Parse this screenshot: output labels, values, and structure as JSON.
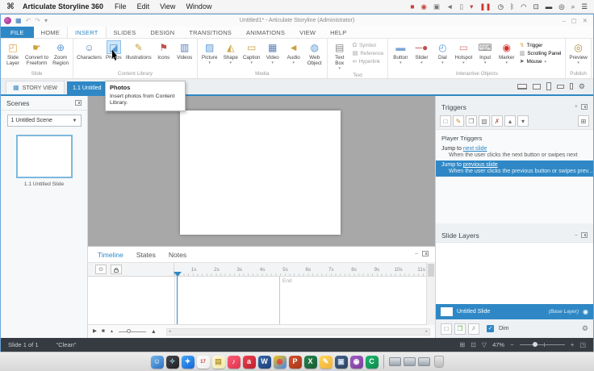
{
  "menubar": {
    "app_name": "Articulate Storyline 360",
    "menus": [
      "File",
      "Edit",
      "View",
      "Window"
    ],
    "status_icons": [
      {
        "name": "screen-record-stop-icon",
        "glyph": "■",
        "color": "#c8463c"
      },
      {
        "name": "record-dot-icon",
        "glyph": "◉",
        "color": "#c8463c"
      },
      {
        "name": "camera-status-icon",
        "glyph": "▣",
        "color": "#787878"
      },
      {
        "name": "volume-status-icon",
        "glyph": "◄",
        "color": "#787878"
      },
      {
        "name": "clipboard-status-icon",
        "glyph": "▯",
        "color": "#787878"
      },
      {
        "name": "notification-dot-icon",
        "glyph": "▾",
        "color": "#b8473c"
      },
      {
        "name": "pause-icon",
        "glyph": "❚❚",
        "color": "#d0342c"
      },
      {
        "name": "clock-icon",
        "glyph": "◷",
        "color": "#3a3a3a"
      },
      {
        "name": "bluetooth-icon",
        "glyph": "ᛒ",
        "color": "#3a3a3a"
      },
      {
        "name": "wifi-icon",
        "glyph": "◠",
        "color": "#3a3a3a"
      },
      {
        "name": "airplay-icon",
        "glyph": "⊡",
        "color": "#3a3a3a"
      },
      {
        "name": "battery-icon",
        "glyph": "▬",
        "color": "#3a3a3a"
      },
      {
        "name": "account-icon",
        "glyph": "◎",
        "color": "#3a3a3a"
      },
      {
        "name": "spotlight-search-icon",
        "glyph": "⌕",
        "color": "#3a3a3a"
      },
      {
        "name": "control-center-icon",
        "glyph": "☰",
        "color": "#3a3a3a"
      }
    ]
  },
  "titlebar": {
    "title": "Untitled1* - Articulate Storyline (Administrator)",
    "quick_access": [
      {
        "name": "storyline-app-icon",
        "type": "circle"
      },
      {
        "name": "save-button",
        "glyph": "▦",
        "color": "#2e75b6"
      },
      {
        "name": "undo-button",
        "glyph": "↶",
        "color": "#bcbcbc"
      },
      {
        "name": "redo-button",
        "glyph": "↷",
        "color": "#bcbcbc"
      },
      {
        "name": "quick-access-dropdown",
        "glyph": "▾",
        "color": "#9a9a9a"
      }
    ],
    "window_controls": [
      {
        "name": "minimize-button",
        "glyph": "–"
      },
      {
        "name": "maximize-button",
        "glyph": "▢"
      },
      {
        "name": "close-button",
        "glyph": "✕"
      }
    ]
  },
  "ribbon": {
    "tabs": [
      {
        "label": "FILE",
        "type": "file"
      },
      {
        "label": "HOME"
      },
      {
        "label": "INSERT",
        "active": true
      },
      {
        "label": "SLIDES"
      },
      {
        "label": "DESIGN"
      },
      {
        "label": "TRANSITIONS"
      },
      {
        "label": "ANIMATIONS"
      },
      {
        "label": "VIEW"
      },
      {
        "label": "HELP"
      }
    ],
    "groups": [
      {
        "name": "Slide",
        "buttons": [
          {
            "label": "Slide\nLayer",
            "icon": "slide-layer-icon",
            "glyph": "◰",
            "color": "#e0a04a"
          },
          {
            "label": "Convert to\nFreeform",
            "icon": "convert-to-freeform-icon",
            "glyph": "☛",
            "color": "#caa23c"
          },
          {
            "label": "Zoom\nRegion",
            "icon": "zoom-region-icon",
            "glyph": "⊕",
            "color": "#5b9bd5"
          }
        ]
      },
      {
        "name": "Content Library",
        "buttons": [
          {
            "label": "Characters",
            "icon": "characters-icon",
            "glyph": "☺",
            "color": "#5b7fb5"
          },
          {
            "label": "Photos",
            "icon": "photos-icon",
            "glyph": "◪",
            "color": "#5b9bd5",
            "highlighted": true
          },
          {
            "label": "Illustrations",
            "icon": "illustrations-icon",
            "glyph": "✎",
            "color": "#caa23c"
          },
          {
            "label": "Icons",
            "icon": "icons-icon",
            "glyph": "⚑",
            "color": "#c05050"
          },
          {
            "label": "Videos",
            "icon": "videos-icon",
            "glyph": "▥",
            "color": "#5b7fb5"
          }
        ]
      },
      {
        "name": "Media",
        "buttons": [
          {
            "label": "Picture",
            "icon": "picture-icon",
            "glyph": "▨",
            "color": "#5b9bd5",
            "arrow": true
          },
          {
            "label": "Shape",
            "icon": "shape-icon",
            "glyph": "◭",
            "color": "#caa23c",
            "arrow": true
          },
          {
            "label": "Caption",
            "icon": "caption-icon",
            "glyph": "▭",
            "color": "#caa23c",
            "arrow": true
          },
          {
            "label": "Video",
            "icon": "video-icon",
            "glyph": "▦",
            "color": "#5b7fb5",
            "arrow": true
          },
          {
            "label": "Audio",
            "icon": "audio-icon",
            "glyph": "◄",
            "color": "#caa23c",
            "arrow": true
          },
          {
            "label": "Web\nObject",
            "icon": "web-object-icon",
            "glyph": "◍",
            "color": "#5b9bd5"
          }
        ]
      },
      {
        "name": "Text",
        "buttons": [
          {
            "label": "Text\nBox",
            "icon": "text-box-icon",
            "glyph": "▤",
            "color": "#8a8a8a",
            "arrow": true
          }
        ],
        "small": [
          {
            "label": "Symbol",
            "icon": "symbol-icon",
            "glyph": "Ω",
            "color": "#9a9a9a",
            "muted": true
          },
          {
            "label": "Reference",
            "icon": "reference-icon",
            "glyph": "▤",
            "color": "#9a9a9a",
            "muted": true
          },
          {
            "label": "Hyperlink",
            "icon": "hyperlink-icon",
            "glyph": "∞",
            "color": "#9a9a9a",
            "muted": true
          }
        ]
      },
      {
        "name": "Interactive Objects",
        "buttons": [
          {
            "label": "Button",
            "icon": "button-icon",
            "glyph": "▬",
            "color": "#7da7d8",
            "arrow": true
          },
          {
            "label": "Slider",
            "icon": "slider-icon",
            "glyph": "─●",
            "color": "#c0504d",
            "arrow": true
          },
          {
            "label": "Dial",
            "icon": "dial-icon",
            "glyph": "◴",
            "color": "#5b9bd5",
            "arrow": true
          },
          {
            "label": "Hotspot",
            "icon": "hotspot-icon",
            "glyph": "▭",
            "color": "#d08080",
            "arrow": true
          },
          {
            "label": "Input",
            "icon": "input-icon",
            "glyph": "⌨",
            "color": "#8a8a8a",
            "arrow": true
          },
          {
            "label": "Marker",
            "icon": "marker-icon",
            "glyph": "◉",
            "color": "#d0342c",
            "arrow": true
          }
        ],
        "small": [
          {
            "label": "Trigger",
            "icon": "trigger-icon",
            "glyph": "↯",
            "color": "#e0a04a"
          },
          {
            "label": "Scrolling Panel",
            "icon": "scrolling-panel-icon",
            "glyph": "▥",
            "color": "#8a8a8a"
          },
          {
            "label": "Mouse",
            "icon": "mouse-icon",
            "glyph": "➤",
            "color": "#555555",
            "arrow": true
          }
        ]
      },
      {
        "name": "Publish",
        "buttons": [
          {
            "label": "Preview",
            "icon": "preview-icon",
            "glyph": "◎",
            "color": "#b0893c",
            "arrow": true
          }
        ]
      }
    ]
  },
  "view_tabs": {
    "story_view": "STORY VIEW",
    "active_slide": "1.1 Untitled "
  },
  "tooltip": {
    "title": "Photos",
    "body": "Insert photos from Content Library."
  },
  "scenes": {
    "title": "Scenes",
    "scene_selector": "1 Untitled Scene",
    "slide_label": "1.1 Untitled Slide"
  },
  "triggers": {
    "title": "Triggers",
    "toolbar_icons": [
      {
        "name": "new-trigger-icon",
        "glyph": "□",
        "color": "#777777"
      },
      {
        "name": "edit-trigger-icon",
        "glyph": "✎",
        "color": "#c98c2c"
      },
      {
        "name": "copy-trigger-icon",
        "glyph": "❐",
        "color": "#777777"
      },
      {
        "name": "paste-trigger-icon",
        "glyph": "▧",
        "color": "#777777"
      },
      {
        "name": "delete-trigger-icon",
        "glyph": "✗",
        "color": "#a95c52"
      },
      {
        "name": "move-trigger-up-icon",
        "glyph": "▴",
        "color": "#666666"
      },
      {
        "name": "move-trigger-down-icon",
        "glyph": "▾",
        "color": "#666666"
      }
    ],
    "variables_icon": {
      "name": "manage-variables-icon",
      "glyph": "⊞",
      "color": "#666666"
    },
    "section_title": "Player Triggers",
    "items": [
      {
        "prefix": "Jump to ",
        "link": "next slide",
        "desc": "When the user clicks the next button or swipes next",
        "selected": false
      },
      {
        "prefix": "Jump to ",
        "link": "previous slide",
        "desc": "When the user clicks the previous button or swipes prev...",
        "selected": true
      }
    ]
  },
  "slide_layers": {
    "title": "Slide Layers",
    "base_row": {
      "name": "Untitled Slide",
      "badge": "(Base Layer)"
    },
    "toolbar": {
      "icons": [
        {
          "name": "new-layer-icon",
          "glyph": "□",
          "color": "#777777"
        },
        {
          "name": "duplicate-layer-icon",
          "glyph": "❐",
          "color": "#5a9e4b"
        },
        {
          "name": "delete-layer-icon",
          "glyph": "✗",
          "color": "#bbbbbb"
        }
      ],
      "dim_label": "Dim",
      "dim_checked": true
    }
  },
  "timeline": {
    "tabs": [
      {
        "label": "Timeline",
        "active": true
      },
      {
        "label": "States"
      },
      {
        "label": "Notes"
      }
    ],
    "ticks": [
      "1s",
      "2s",
      "3s",
      "4s",
      "5s",
      "6s",
      "7s",
      "8s",
      "9s",
      "10s",
      "11s"
    ],
    "end_label": "End"
  },
  "statusbar": {
    "slide_info": "Slide 1 of 1",
    "theme_name": "\"Clean\"",
    "left_icons": [
      {
        "name": "grid-view-icon",
        "glyph": "⊞"
      },
      {
        "name": "fit-slide-icon",
        "glyph": "⊡"
      },
      {
        "name": "filter-icon",
        "glyph": "▽"
      }
    ],
    "zoom_value": "47%",
    "zoom_out_glyph": "−",
    "zoom_in_glyph": "+",
    "fit_window_icon": {
      "name": "fit-to-window-icon",
      "glyph": "◳"
    }
  },
  "dock": {
    "apps": [
      {
        "name": "finder",
        "c1": "#74b6ea",
        "c2": "#2d6fc1",
        "glyph": "☺",
        "fg": "#ffffff"
      },
      {
        "name": "launchpad",
        "c1": "#47474b",
        "c2": "#202024",
        "glyph": "✧",
        "fg": "#9fd4e8"
      },
      {
        "name": "safari",
        "c1": "#45a7f5",
        "c2": "#1565d8",
        "glyph": "✦",
        "fg": "#ffffff"
      },
      {
        "name": "calendar",
        "c1": "#ffffff",
        "c2": "#ededed",
        "glyph": "17",
        "fg": "#d0342c"
      },
      {
        "name": "notes",
        "c1": "#fdf7dd",
        "c2": "#f3e8ac",
        "glyph": "▤",
        "fg": "#b59a2e"
      },
      {
        "name": "music",
        "c1": "#fb5c74",
        "c2": "#e0344f",
        "glyph": "♪",
        "fg": "#ffffff"
      },
      {
        "name": "articulate-360",
        "c1": "#e84350",
        "c2": "#bf1d2d",
        "glyph": "a",
        "fg": "#ffffff"
      },
      {
        "name": "word",
        "c1": "#3465ab",
        "c2": "#1e3f78",
        "glyph": "W",
        "fg": "#ffffff"
      },
      {
        "name": "chrome",
        "c1": "#f4c20d",
        "c2": "#4285f4",
        "glyph": "◉",
        "fg": "#e8453c"
      },
      {
        "name": "powerpoint",
        "c1": "#d35230",
        "c2": "#a63616",
        "glyph": "P",
        "fg": "#ffffff"
      },
      {
        "name": "excel",
        "c1": "#27834b",
        "c2": "#175b35",
        "glyph": "X",
        "fg": "#ffffff"
      },
      {
        "name": "yellow-app",
        "c1": "#ffd558",
        "c2": "#efb13a",
        "glyph": "✎",
        "fg": "#ffffff"
      },
      {
        "name": "storyline-box-app",
        "c1": "#44618c",
        "c2": "#2c415f",
        "glyph": "▣",
        "fg": "#cfe0f0"
      },
      {
        "name": "purple-app",
        "c1": "#a05cc2",
        "c2": "#7c3f9e",
        "glyph": "◉",
        "fg": "#ffffff"
      },
      {
        "name": "camtasia",
        "c1": "#1db56c",
        "c2": "#0f8a4e",
        "glyph": "C",
        "fg": "#ffffff"
      }
    ],
    "minimized_windows": 3
  }
}
